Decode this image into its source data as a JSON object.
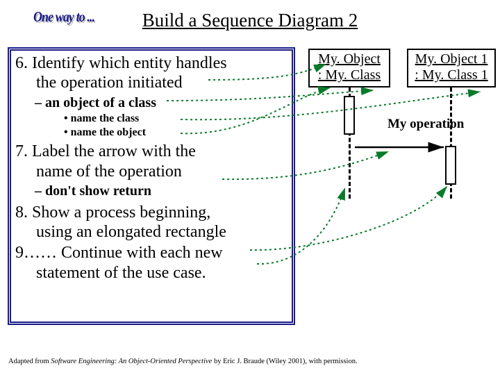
{
  "logo_text": "One way to ...",
  "title": "Build a Sequence Diagram 2",
  "steps": {
    "s6_line1": "6. Identify which entity handles",
    "s6_line2": "the operation initiated",
    "s6_sub": "an object of a class",
    "s6_b1": "name the class",
    "s6_b2": "name the object",
    "s7_line1": "7. Label the arrow with the",
    "s7_line2": "name of the operation",
    "s7_sub": "don't show return",
    "s8_line1": "8. Show a process beginning,",
    "s8_line2": "using an elongated rectangle",
    "s9_line1": "9…… Continue with each new",
    "s9_line2": "statement of the use case."
  },
  "diagram": {
    "obj1_name": "My. Object",
    "obj1_class": ": My. Class",
    "obj2_name": "My. Object 1",
    "obj2_class": ": My. Class 1",
    "operation_label": "My operation"
  },
  "footer": {
    "prefix": "Adapted from ",
    "book": "Software Engineering: An Object-Oriented Perspective",
    "suffix": " by Eric J. Braude (Wiley 2001), with permission."
  }
}
